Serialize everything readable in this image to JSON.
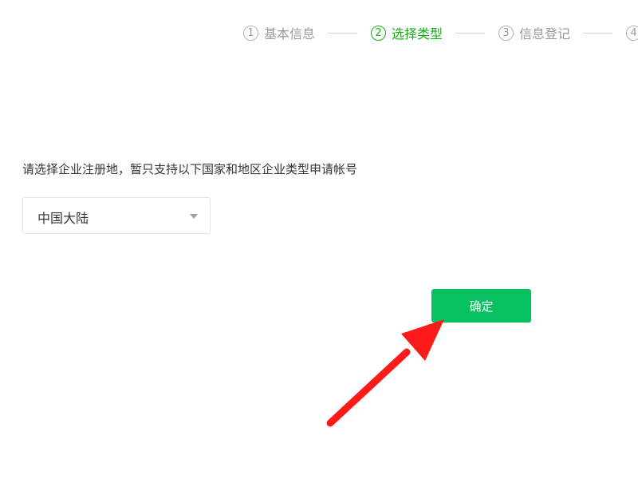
{
  "stepper": {
    "steps": [
      {
        "number": "1",
        "label": "基本信息",
        "state": "done"
      },
      {
        "number": "2",
        "label": "选择类型",
        "state": "active"
      },
      {
        "number": "3",
        "label": "信息登记",
        "state": "pending"
      },
      {
        "number": "4",
        "label": "",
        "state": "pending"
      }
    ],
    "active_color": "#1aad19",
    "inactive_color": "#9a9a9a"
  },
  "form": {
    "instruction": "请选择企业注册地，暂只支持以下国家和地区企业类型申请帐号",
    "region_select": {
      "selected": "中国大陆"
    },
    "confirm_label": "确定",
    "confirm_color": "#07c160"
  },
  "annotation": {
    "arrow_color": "#ff1a1a"
  }
}
